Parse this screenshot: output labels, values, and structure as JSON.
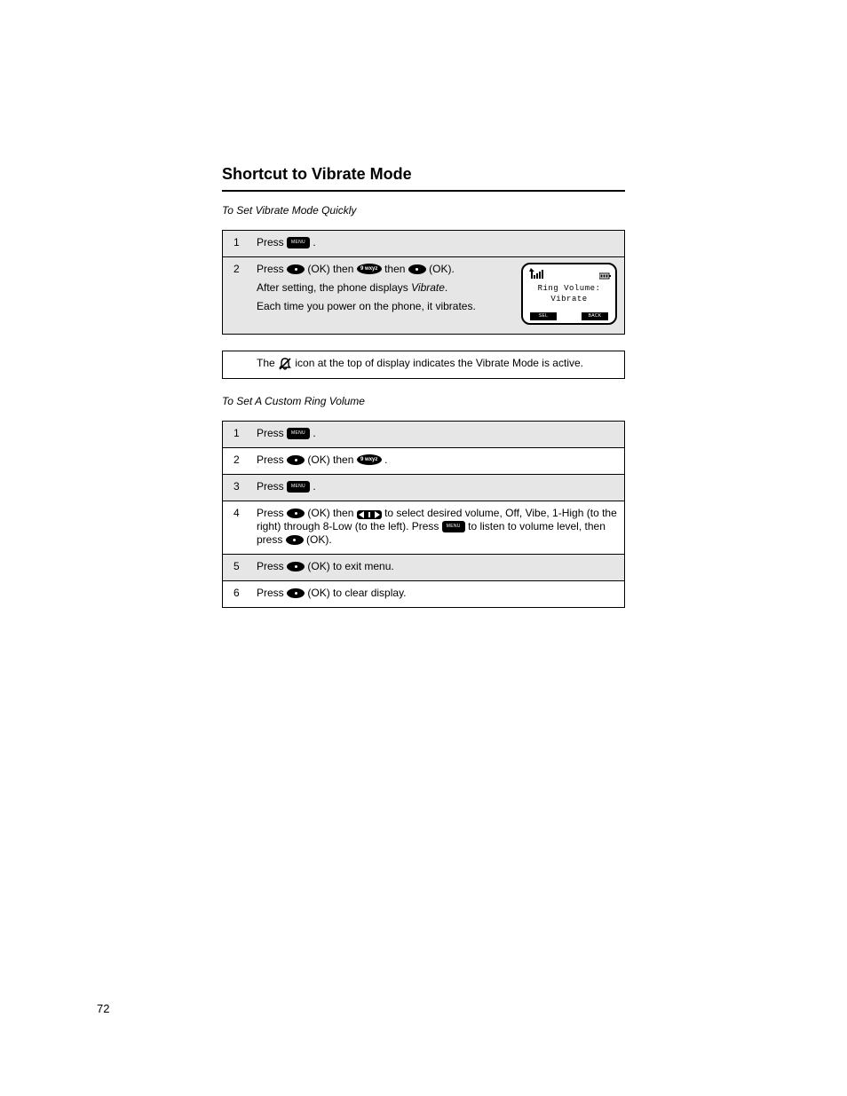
{
  "page_number": "72",
  "section_title": "Shortcut to Vibrate Mode",
  "quick": {
    "heading": "To Set Vibrate Mode Quickly",
    "step1": {
      "num": "1",
      "pre": "Press ",
      "post": "."
    },
    "step2": {
      "num": "2",
      "pre1": "Press ",
      "ok_word": " (OK) then ",
      "mid": " then ",
      "post": " (OK).",
      "sub1_pre": "After setting, the phone displays ",
      "sub1_val": "Vibrate",
      "sub1_post": ".",
      "sub2": "Each time you power on the phone, it vibrates."
    },
    "note_row_pre": "The ",
    "note_row_post": " icon at the top of display indicates the Vibrate Mode is active.",
    "lcd": {
      "line1": "Ring Volume:",
      "line2": "Vibrate",
      "sk_left": "SEL",
      "sk_right": "BACK"
    }
  },
  "custom": {
    "heading": "To Set A Custom Ring Volume",
    "step1": {
      "num": "1",
      "pre": "Press ",
      "post": "."
    },
    "step2": {
      "num": "2",
      "pre": "Press ",
      "mid": " (OK) then ",
      "post": "."
    },
    "step3": {
      "num": "3",
      "pre": "Press ",
      "post": "."
    },
    "step4": {
      "num": "4",
      "pre": "Press ",
      "post1": " (OK) then ",
      "post2": " to select desired volume, Off, Vibe, 1-High (to the right) through 8-Low (to the left). Press ",
      "post3": " to listen to volume level, then press ",
      "post4": " (OK)."
    },
    "step5": {
      "num": "5",
      "pre": "Press ",
      "post": " (OK) to exit menu."
    },
    "step6": {
      "num": "6",
      "pre": "Press ",
      "post": " (OK) to clear display."
    }
  }
}
